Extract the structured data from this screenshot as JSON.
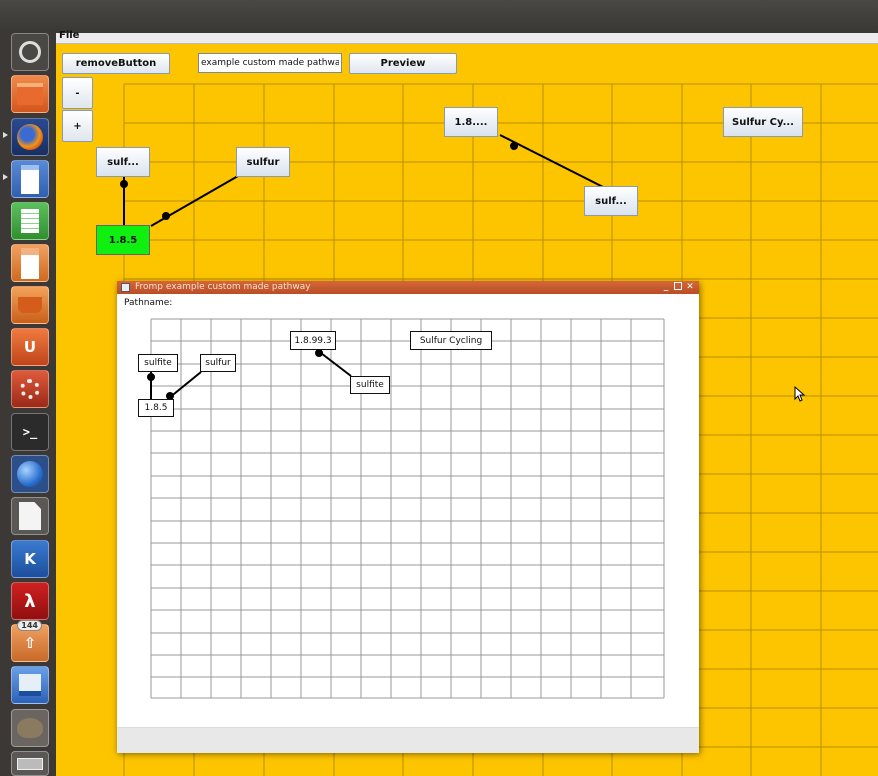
{
  "menubar": {
    "file": "File"
  },
  "toolbar": {
    "remove_label": "removeButton",
    "pathway_name_value": "example custom made pathway",
    "preview_label": "Preview",
    "zoom_out_label": "-",
    "zoom_in_label": "+"
  },
  "canvas_nodes": [
    {
      "label": "sulf..."
    },
    {
      "label": "sulfur"
    },
    {
      "label": "1.8.5"
    },
    {
      "label": "1.8...."
    },
    {
      "label": "sulf..."
    },
    {
      "label": "Sulfur Cy..."
    }
  ],
  "preview_window": {
    "title": "Fromp example custom made pathway",
    "pathname_label": "Pathname:",
    "nodes": [
      {
        "label": "sulfite"
      },
      {
        "label": "sulfur"
      },
      {
        "label": "1.8.5"
      },
      {
        "label": "1.8.99.3"
      },
      {
        "label": "sulfite"
      },
      {
        "label": "Sulfur Cycling"
      }
    ]
  },
  "launcher": {
    "items": [
      {
        "icon": "ubuntu-dash-icon"
      },
      {
        "icon": "files-folder-icon"
      },
      {
        "icon": "firefox-icon"
      },
      {
        "icon": "libreoffice-writer-icon"
      },
      {
        "icon": "libreoffice-calc-icon"
      },
      {
        "icon": "libreoffice-impress-icon"
      },
      {
        "icon": "software-center-icon"
      },
      {
        "icon": "ubuntu-one-icon"
      },
      {
        "icon": "system-settings-icon"
      },
      {
        "icon": "terminal-icon"
      },
      {
        "icon": "google-earth-icon"
      },
      {
        "icon": "text-editor-icon"
      },
      {
        "icon": "kde-app-icon"
      },
      {
        "icon": "acrobat-reader-icon"
      },
      {
        "icon": "update-manager-icon",
        "badge": "144"
      },
      {
        "icon": "disk-utility-icon"
      },
      {
        "icon": "gimp-icon"
      },
      {
        "icon": "removable-drive-icon"
      }
    ]
  },
  "colors": {
    "canvas_bg": "#fdc400",
    "grid_line": "#b89000",
    "selected_node": "#10f010",
    "preview_titlebar": "#c85a2f"
  }
}
